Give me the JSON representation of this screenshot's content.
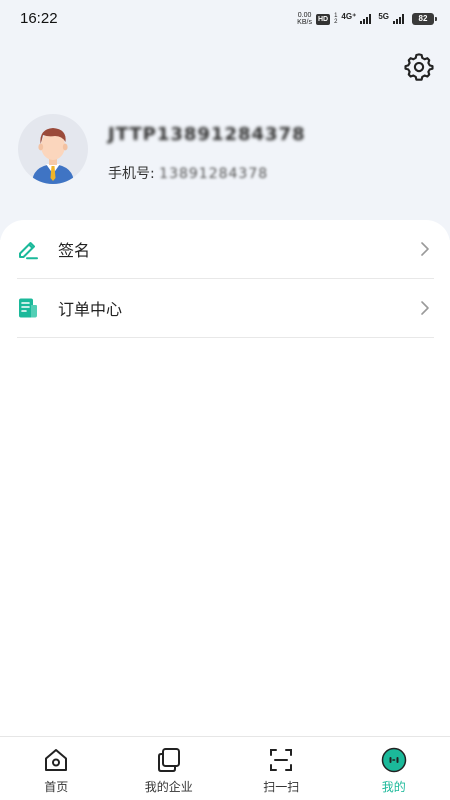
{
  "status_bar": {
    "time": "16:22",
    "speed_value": "0.00",
    "speed_unit": "KB/s",
    "hd_label": "HD",
    "sim1": "1",
    "sim2": "2",
    "network_1": "4G⁺",
    "network_2": "5G",
    "battery": "82"
  },
  "profile": {
    "username": "JTTP13891284378",
    "phone_label": "手机号:",
    "phone_value": "13891284378"
  },
  "menu": {
    "items": [
      {
        "label": "签名",
        "icon": "pen-icon"
      },
      {
        "label": "订单中心",
        "icon": "order-document-icon"
      }
    ]
  },
  "bottom_nav": {
    "items": [
      {
        "label": "首页",
        "icon": "home-icon",
        "active": false
      },
      {
        "label": "我的企业",
        "icon": "enterprise-icon",
        "active": false
      },
      {
        "label": "扫一扫",
        "icon": "scan-icon",
        "active": false
      },
      {
        "label": "我的",
        "icon": "my-profile-icon",
        "active": true
      }
    ]
  },
  "colors": {
    "accent": "#1bb99a",
    "header_background": "#f1f4f9",
    "text_primary": "#222222"
  }
}
